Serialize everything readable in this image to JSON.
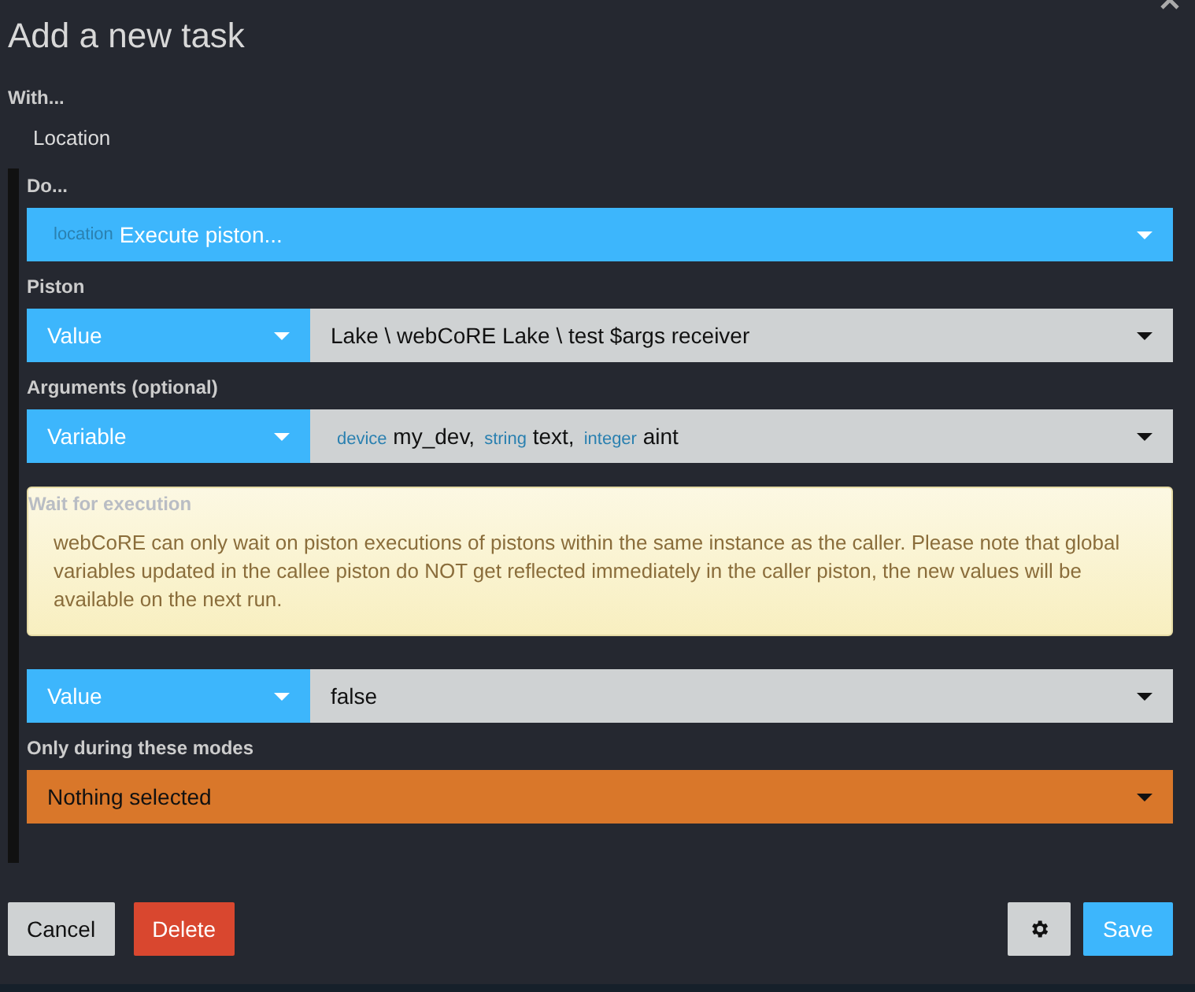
{
  "dialog": {
    "title": "Add a new task"
  },
  "with": {
    "label": "With...",
    "value": "Location"
  },
  "do": {
    "label": "Do...",
    "prefix": "location",
    "value": "Execute piston..."
  },
  "piston": {
    "label": "Piston",
    "mode": "Value",
    "value": "Lake \\ webCoRE Lake \\ test $args receiver"
  },
  "arguments": {
    "label": "Arguments (optional)",
    "mode": "Variable",
    "items": [
      {
        "type": "device",
        "name": "my_dev,"
      },
      {
        "type": "string",
        "name": "text,"
      },
      {
        "type": "integer",
        "name": "aint"
      }
    ]
  },
  "wait": {
    "label": "Wait for execution",
    "note": "webCoRE can only wait on piston executions of pistons within the same instance as the caller. Please note that global variables updated in the callee piston do NOT get reflected immediately in the caller piston, the new values will be available on the next run.",
    "mode": "Value",
    "value": "false"
  },
  "modes": {
    "label": "Only during these modes",
    "value": "Nothing selected"
  },
  "buttons": {
    "cancel": "Cancel",
    "delete": "Delete",
    "save": "Save"
  }
}
